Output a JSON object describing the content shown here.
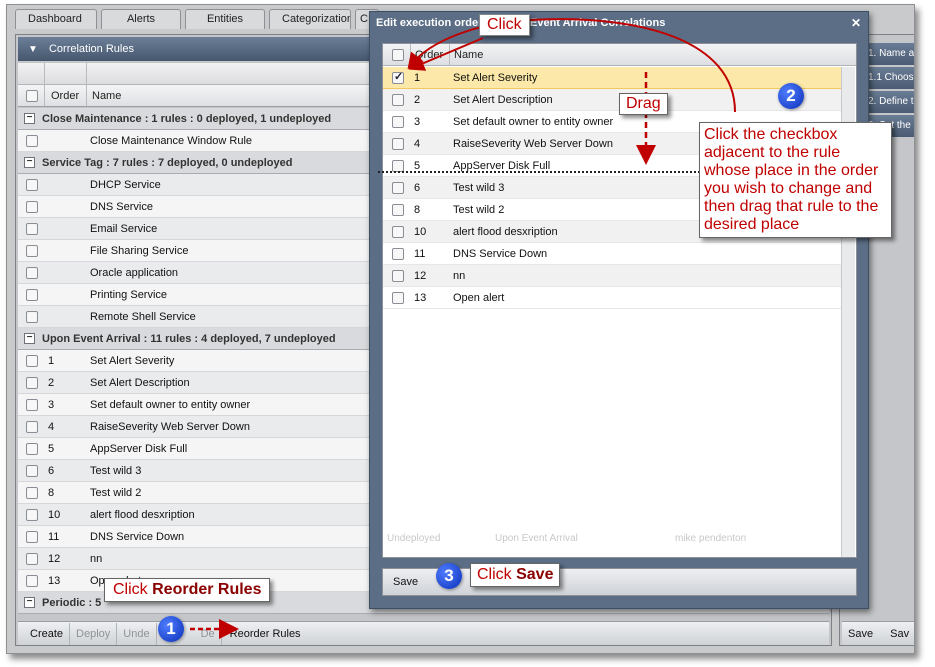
{
  "tabs": [
    "Dashboard",
    "Alerts",
    "Entities",
    "Categorization",
    "C"
  ],
  "panel": {
    "title": "Correlation Rules",
    "col_order": "Order",
    "col_name": "Name"
  },
  "groups": [
    {
      "label": "Close Maintenance : 1 rules : 0 deployed, 1 undeployed",
      "rows": [
        {
          "order": "",
          "name": "Close Maintenance Window Rule"
        }
      ]
    },
    {
      "label": "Service Tag : 7 rules : 7 deployed, 0 undeployed",
      "rows": [
        {
          "order": "",
          "name": "DHCP Service"
        },
        {
          "order": "",
          "name": "DNS Service"
        },
        {
          "order": "",
          "name": "Email Service"
        },
        {
          "order": "",
          "name": "File Sharing Service"
        },
        {
          "order": "",
          "name": "Oracle application"
        },
        {
          "order": "",
          "name": "Printing Service"
        },
        {
          "order": "",
          "name": "Remote Shell Service"
        }
      ]
    },
    {
      "label": "Upon Event Arrival : 11 rules : 4 deployed, 7 undeployed",
      "rows": [
        {
          "order": "1",
          "name": "Set Alert Severity"
        },
        {
          "order": "2",
          "name": "Set Alert Description"
        },
        {
          "order": "3",
          "name": "Set default owner to entity owner"
        },
        {
          "order": "4",
          "name": "RaiseSeverity Web Server Down"
        },
        {
          "order": "5",
          "name": "AppServer Disk Full"
        },
        {
          "order": "6",
          "name": "Test wild 3"
        },
        {
          "order": "8",
          "name": "Test wild 2"
        },
        {
          "order": "10",
          "name": "alert flood desxription"
        },
        {
          "order": "11",
          "name": "DNS Service Down"
        },
        {
          "order": "12",
          "name": "nn"
        },
        {
          "order": "13",
          "name": "Open alert"
        }
      ]
    },
    {
      "label": "Periodic : 5",
      "rows": []
    }
  ],
  "bottom_buttons": {
    "create": "Create",
    "deploy": "Deploy",
    "undeploy": "Unde",
    "delete": "De",
    "reorder": "Reorder Rules"
  },
  "right_panel": {
    "steps": [
      "1. Name a",
      "1.1 Choos",
      "2. Define t",
      "3. Set the"
    ],
    "save": "Save",
    "save_as": "Sav"
  },
  "dialog": {
    "title": "Edit execution order of Upon Event Arrival Correlations",
    "col_order": "Order",
    "col_name": "Name",
    "rows": [
      {
        "order": "1",
        "name": "Set Alert Severity",
        "checked": true
      },
      {
        "order": "2",
        "name": "Set Alert Description",
        "checked": false
      },
      {
        "order": "3",
        "name": "Set default owner to entity owner",
        "checked": false
      },
      {
        "order": "4",
        "name": "RaiseSeverity Web Server Down",
        "checked": false
      },
      {
        "order": "5",
        "name": "AppServer Disk Full",
        "checked": false
      },
      {
        "order": "6",
        "name": "Test wild 3",
        "checked": false
      },
      {
        "order": "8",
        "name": "Test wild 2",
        "checked": false
      },
      {
        "order": "10",
        "name": "alert flood desxription",
        "checked": false
      },
      {
        "order": "11",
        "name": "DNS Service Down",
        "checked": false
      },
      {
        "order": "12",
        "name": "nn",
        "checked": false
      },
      {
        "order": "13",
        "name": "Open alert",
        "checked": false
      }
    ],
    "ghost_row": {
      "status": "Undeployed",
      "category": "Upon Event Arrival",
      "owner": "mike pendenton"
    },
    "save_label": "Save"
  },
  "callouts": {
    "click": "Click",
    "drag": "Drag",
    "step2_text": "Click the checkbox adjacent to the rule whose place in the order you wish to change and then drag that rule to the desired place",
    "step1_prefix": "Click ",
    "step1_bold": "Reorder Rules",
    "step3_prefix": "Click ",
    "step3_bold": "Save",
    "badge1": "1",
    "badge2": "2",
    "badge3": "3"
  },
  "colors": {
    "annotation_red": "#c00000",
    "badge_blue": "#0a2fb8",
    "title_bar": "#5b6e86",
    "selected_row": "#fce8a8"
  }
}
